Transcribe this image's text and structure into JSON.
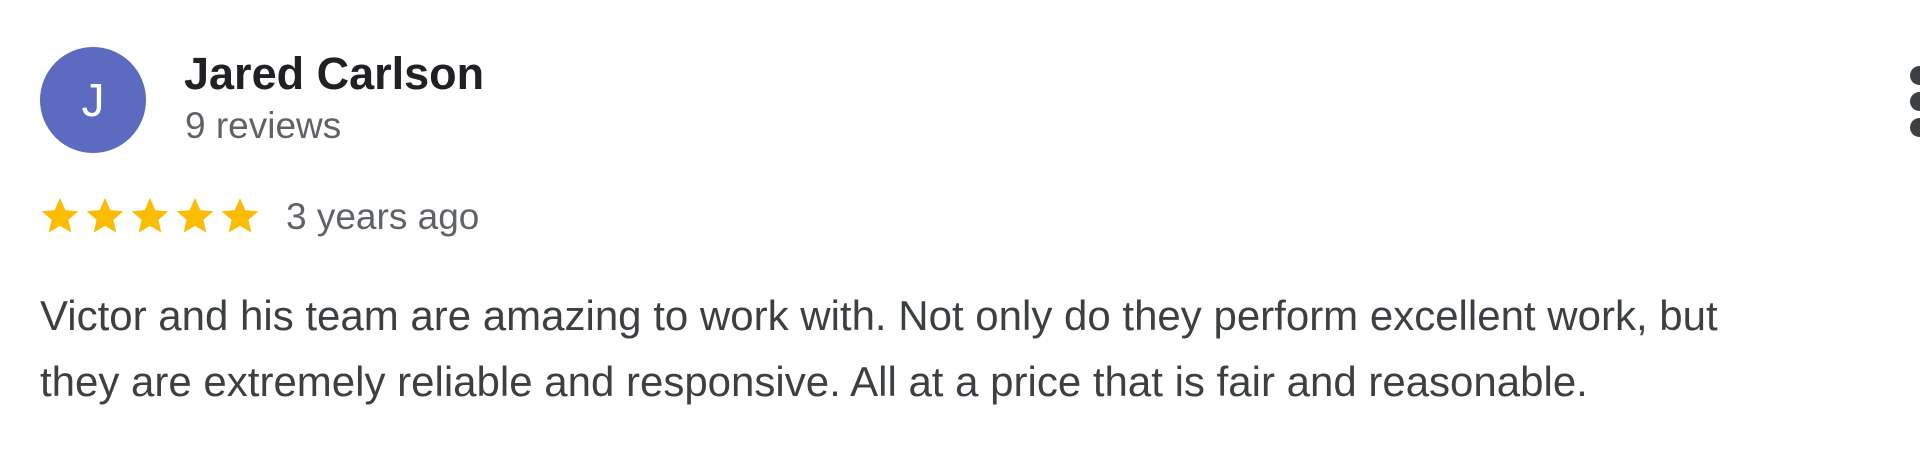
{
  "review": {
    "avatar_letter": "J",
    "author_name": "Jared Carlson",
    "review_count": "9 reviews",
    "rating": 5,
    "rating_max": 5,
    "date": "3 years ago",
    "text_lines": [
      "Victor and his team are amazing to work with. Not only do they perform excellent work, but",
      "they are extremely reliable and responsive. All at a price that is fair and reasonable."
    ],
    "more_icon": "more-vert-icon"
  },
  "colors": {
    "avatar_bg": "#5c6bc0",
    "star": "#fbbc04",
    "name": "#202124",
    "secondary": "#5f6368",
    "body": "#3c4043"
  }
}
